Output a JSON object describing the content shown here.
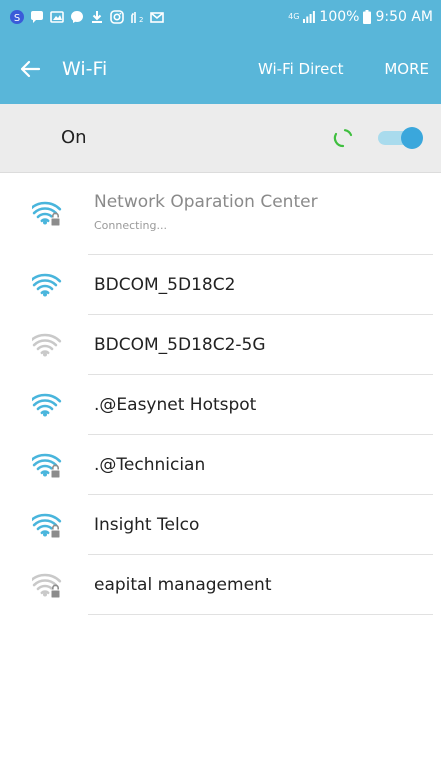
{
  "status_bar": {
    "network_type": "4G",
    "battery": "100%",
    "time": "9:50 AM",
    "colors": {
      "background": "#59b6d9",
      "icon": "#ffffff"
    },
    "left_icons": [
      "notification-s-icon",
      "chat-icon",
      "gallery-icon",
      "messenger-icon",
      "download-icon",
      "instagram-icon",
      "data-usage-icon",
      "mail-icon"
    ]
  },
  "app_bar": {
    "title": "Wi-Fi",
    "wifi_direct": "Wi-Fi Direct",
    "more": "MORE",
    "back_icon": "back-arrow-icon"
  },
  "toggle": {
    "label": "On",
    "state": "on",
    "colors": {
      "row_bg": "#ececec",
      "track": "#a9dbed",
      "knob": "#3aa7dc",
      "spinner": "#3fbf3f"
    }
  },
  "networks": [
    {
      "name": "Network Oparation Center",
      "status": "Connecting...",
      "locked": true,
      "strength": 4,
      "dimmed": true
    },
    {
      "name": "BDCOM_5D18C2",
      "locked": false,
      "strength": 4
    },
    {
      "name": "BDCOM_5D18C2-5G",
      "locked": false,
      "strength": 2
    },
    {
      "name": ".@Easynet Hotspot",
      "locked": false,
      "strength": 4
    },
    {
      "name": ".@Technician",
      "locked": true,
      "strength": 4
    },
    {
      "name": "Insight Telco",
      "locked": true,
      "strength": 4
    },
    {
      "name": "eapital management",
      "locked": true,
      "strength": 2
    }
  ],
  "colors": {
    "wifi_active": "#49b5dc",
    "wifi_weak": "#c9c9c9",
    "lock": "#8c8c8c"
  }
}
